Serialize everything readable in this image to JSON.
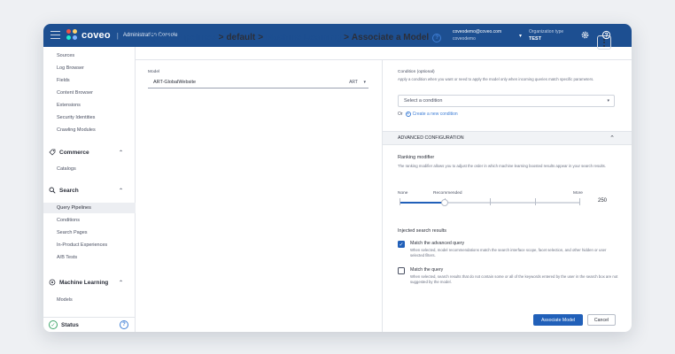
{
  "header": {
    "brand": "coveo",
    "console_title": "Administration Console",
    "user_email": "coveodemo@coveo.com",
    "user_org": "coveodemo",
    "org_type_label": "Organization type",
    "org_type_value": "TEST"
  },
  "sidebar": {
    "items_top": [
      "Sources",
      "Log Browser",
      "Fields",
      "Content Browser",
      "Extensions",
      "Security Identities",
      "Crawling Modules"
    ],
    "commerce": {
      "label": "Commerce",
      "items": [
        "Catalogs"
      ]
    },
    "search": {
      "label": "Search",
      "items": [
        "Query Pipelines",
        "Conditions",
        "Search Pages",
        "In-Product Experiences",
        "A/B Tests"
      ]
    },
    "ml": {
      "label": "Machine Learning",
      "items": [
        "Models"
      ]
    },
    "status_label": "Status"
  },
  "breadcrumb": {
    "items": [
      "Query Pipelines",
      "default",
      "Machine Learning"
    ],
    "current": "Associate a Model"
  },
  "model": {
    "label": "Model",
    "selected": "ART-GlobalWebsite",
    "tag": "ART"
  },
  "condition": {
    "label": "Condition (optional)",
    "hint": "Apply a condition when you want or need to apply the model only when incoming queries match specific parameters.",
    "placeholder": "Select a condition",
    "or_text": "Or",
    "create_link": "Create a new condition"
  },
  "advanced": {
    "title": "ADVANCED CONFIGURATION",
    "ranking_title": "Ranking modifier",
    "ranking_hint": "The ranking modifier allows you to adjust the order in which machine learning boosted results appear in your search results.",
    "slider_less": "None",
    "slider_recommended": "Recommended",
    "slider_more": "More",
    "slider_value": "250",
    "slider_fraction": 0.25,
    "injected_title": "Injected search results",
    "opt1_label": "Match the advanced query",
    "opt1_desc": "When selected, model recommendations match the search interface scope, facet selection, and other hidden or user selected filters.",
    "opt1_checked": true,
    "opt2_label": "Match the query",
    "opt2_desc": "When selected, search results that do not contain some or all of the keywords entered by the user in the search box are not suggested by the model.",
    "opt2_checked": false
  },
  "actions": {
    "primary": "Associate Model",
    "cancel": "Cancel"
  },
  "colors": {
    "topbar": "#1d4f91",
    "accent": "#2160b9",
    "link": "#3f7fd6"
  }
}
